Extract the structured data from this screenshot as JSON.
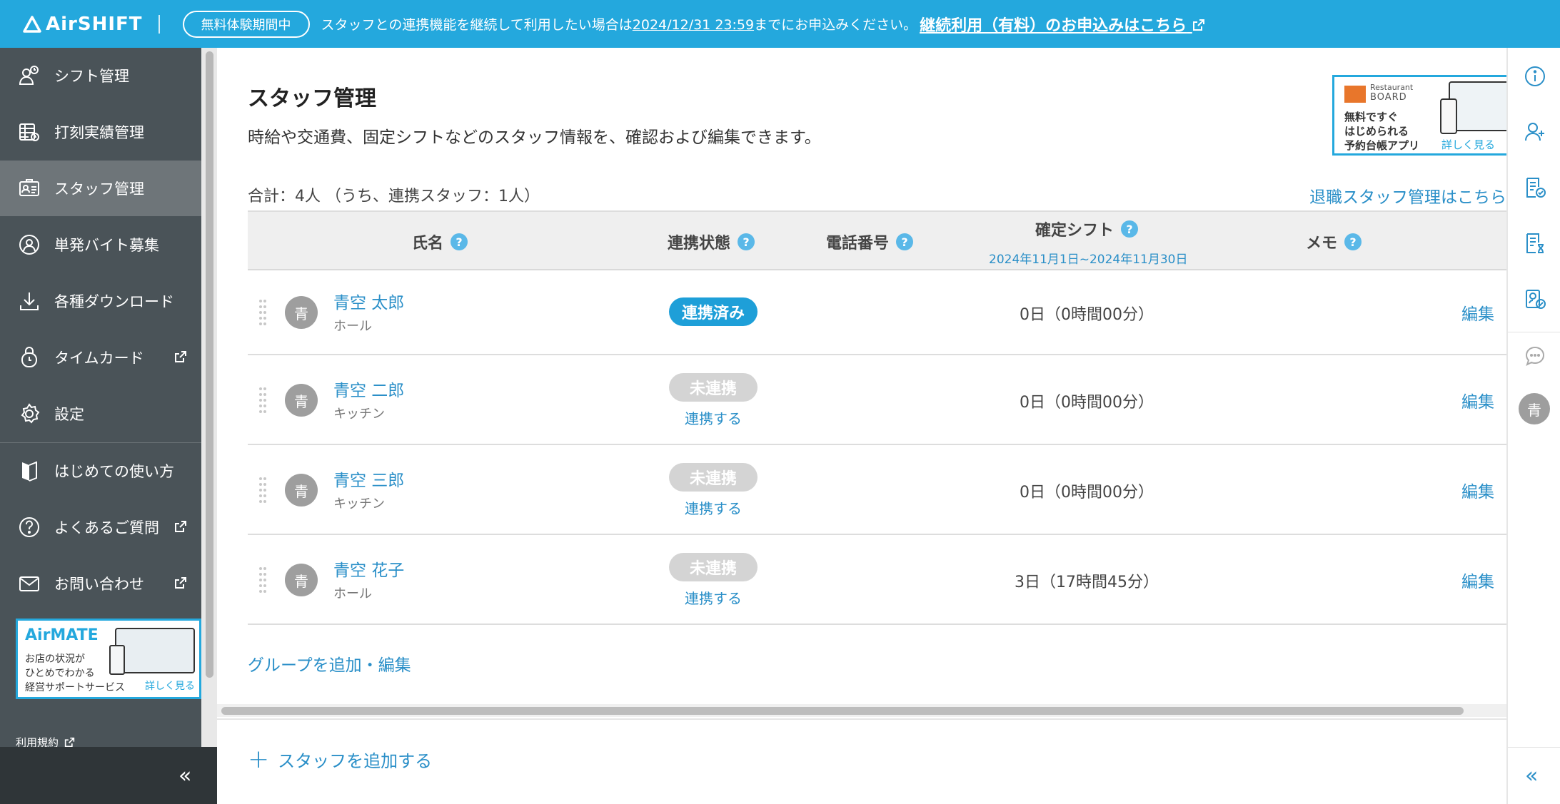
{
  "banner": {
    "brand": "AirSHIFT",
    "trial_badge": "無料体験期間中",
    "text_before": "スタッフとの連携機能を継続して利用したい場合は",
    "deadline": "2024/12/31 23:59",
    "text_after": "までにお申込みください。",
    "apply_link": "継続利用（有料）のお申込みはこちら"
  },
  "sidebar": {
    "items": [
      {
        "label": "シフト管理",
        "icon": "shift-icon"
      },
      {
        "label": "打刻実績管理",
        "icon": "punch-record-icon"
      },
      {
        "label": "スタッフ管理",
        "icon": "staff-card-icon"
      },
      {
        "label": "単発バイト募集",
        "icon": "recruit-icon"
      },
      {
        "label": "各種ダウンロード",
        "icon": "download-icon"
      },
      {
        "label": "タイムカード",
        "icon": "timecard-icon"
      },
      {
        "label": "設定",
        "icon": "gear-icon"
      },
      {
        "label": "はじめての使い方",
        "icon": "guide-icon"
      },
      {
        "label": "よくあるご質問",
        "icon": "question-icon"
      },
      {
        "label": "お問い合わせ",
        "icon": "mail-icon"
      }
    ],
    "airmate": {
      "brand": "AirMATE",
      "line1": "お店の状況が",
      "line2": "ひとめでわかる",
      "line3": "経営サポートサービス",
      "more": "詳しく見る"
    },
    "terms": "利用規約",
    "collapse": "«"
  },
  "main": {
    "title": "スタッフ管理",
    "description": "時給や交通費、固定シフトなどのスタッフ情報を、確認および編集できます。",
    "total": "合計：4人 （うち、連携スタッフ：1人）",
    "retired_link": "退職スタッフ管理はこちら",
    "ad": {
      "brand_small": "Restaurant",
      "brand": "BOARD",
      "line1": "無料ですぐ",
      "line2": "はじめられる",
      "line3": "予約台帳アプリ",
      "more": "詳しく見る"
    },
    "columns": {
      "name": "氏名",
      "status": "連携状態",
      "phone": "電話番号",
      "shift": "確定シフト",
      "shift_range": "2024年11月1日~2024年11月30日",
      "memo": "メモ"
    },
    "rows": [
      {
        "avatar": "青",
        "name": "青空 太郎",
        "group": "ホール",
        "status": "連携済み",
        "linked": true,
        "action": "",
        "shift": "0日（0時間00分）",
        "edit": "編集"
      },
      {
        "avatar": "青",
        "name": "青空 二郎",
        "group": "キッチン",
        "status": "未連携",
        "linked": false,
        "action": "連携する",
        "shift": "0日（0時間00分）",
        "edit": "編集"
      },
      {
        "avatar": "青",
        "name": "青空 三郎",
        "group": "キッチン",
        "status": "未連携",
        "linked": false,
        "action": "連携する",
        "shift": "0日（0時間00分）",
        "edit": "編集"
      },
      {
        "avatar": "青",
        "name": "青空 花子",
        "group": "ホール",
        "status": "未連携",
        "linked": false,
        "action": "連携する",
        "shift": "3日（17時間45分）",
        "edit": "編集"
      }
    ],
    "group_link": "グループを追加・編集",
    "add_staff": "スタッフを追加する",
    "help_mark": "?"
  },
  "rail": {
    "avatar": "青",
    "collapse": "«"
  },
  "colors": {
    "brand_blue": "#24a8dd",
    "sidebar_bg": "#4a5358",
    "link": "#2a8fc8",
    "linked_badge": "#1e9fd8",
    "unlinked_badge": "#d4d4d4"
  }
}
